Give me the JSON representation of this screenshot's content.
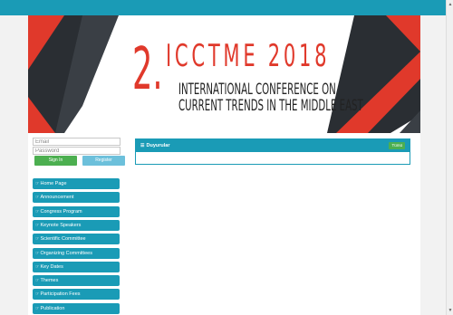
{
  "banner": {
    "number": "2.",
    "title": "ICCTME 2018",
    "line1": "INTERNATIONAL CONFERENCE ON",
    "line2": "CURRENT TRENDS IN THE MIDDLE EAST"
  },
  "login": {
    "email_placeholder": "Email",
    "password_placeholder": "Password",
    "signin_label": "Sign In",
    "register_label": "Register"
  },
  "menu": {
    "items": [
      {
        "label": "Home Page"
      },
      {
        "label": "Announcement"
      },
      {
        "label": "Congress Program"
      },
      {
        "label": "Keynote Speakers"
      },
      {
        "label": "Scientific Committee"
      },
      {
        "label": "Organizing Committees"
      },
      {
        "label": "Key Dates"
      },
      {
        "label": "Themes"
      },
      {
        "label": "Participation Fees"
      },
      {
        "label": "Publication"
      }
    ],
    "icon": "hand-pointing-icon"
  },
  "announcements": {
    "title": "Duyurular",
    "badge": "Tümü",
    "icon": "list-icon"
  },
  "colors": {
    "accent": "#1a9bb6",
    "brand_red": "#e0392b",
    "success": "#4caf50",
    "info": "#6cc0db"
  }
}
